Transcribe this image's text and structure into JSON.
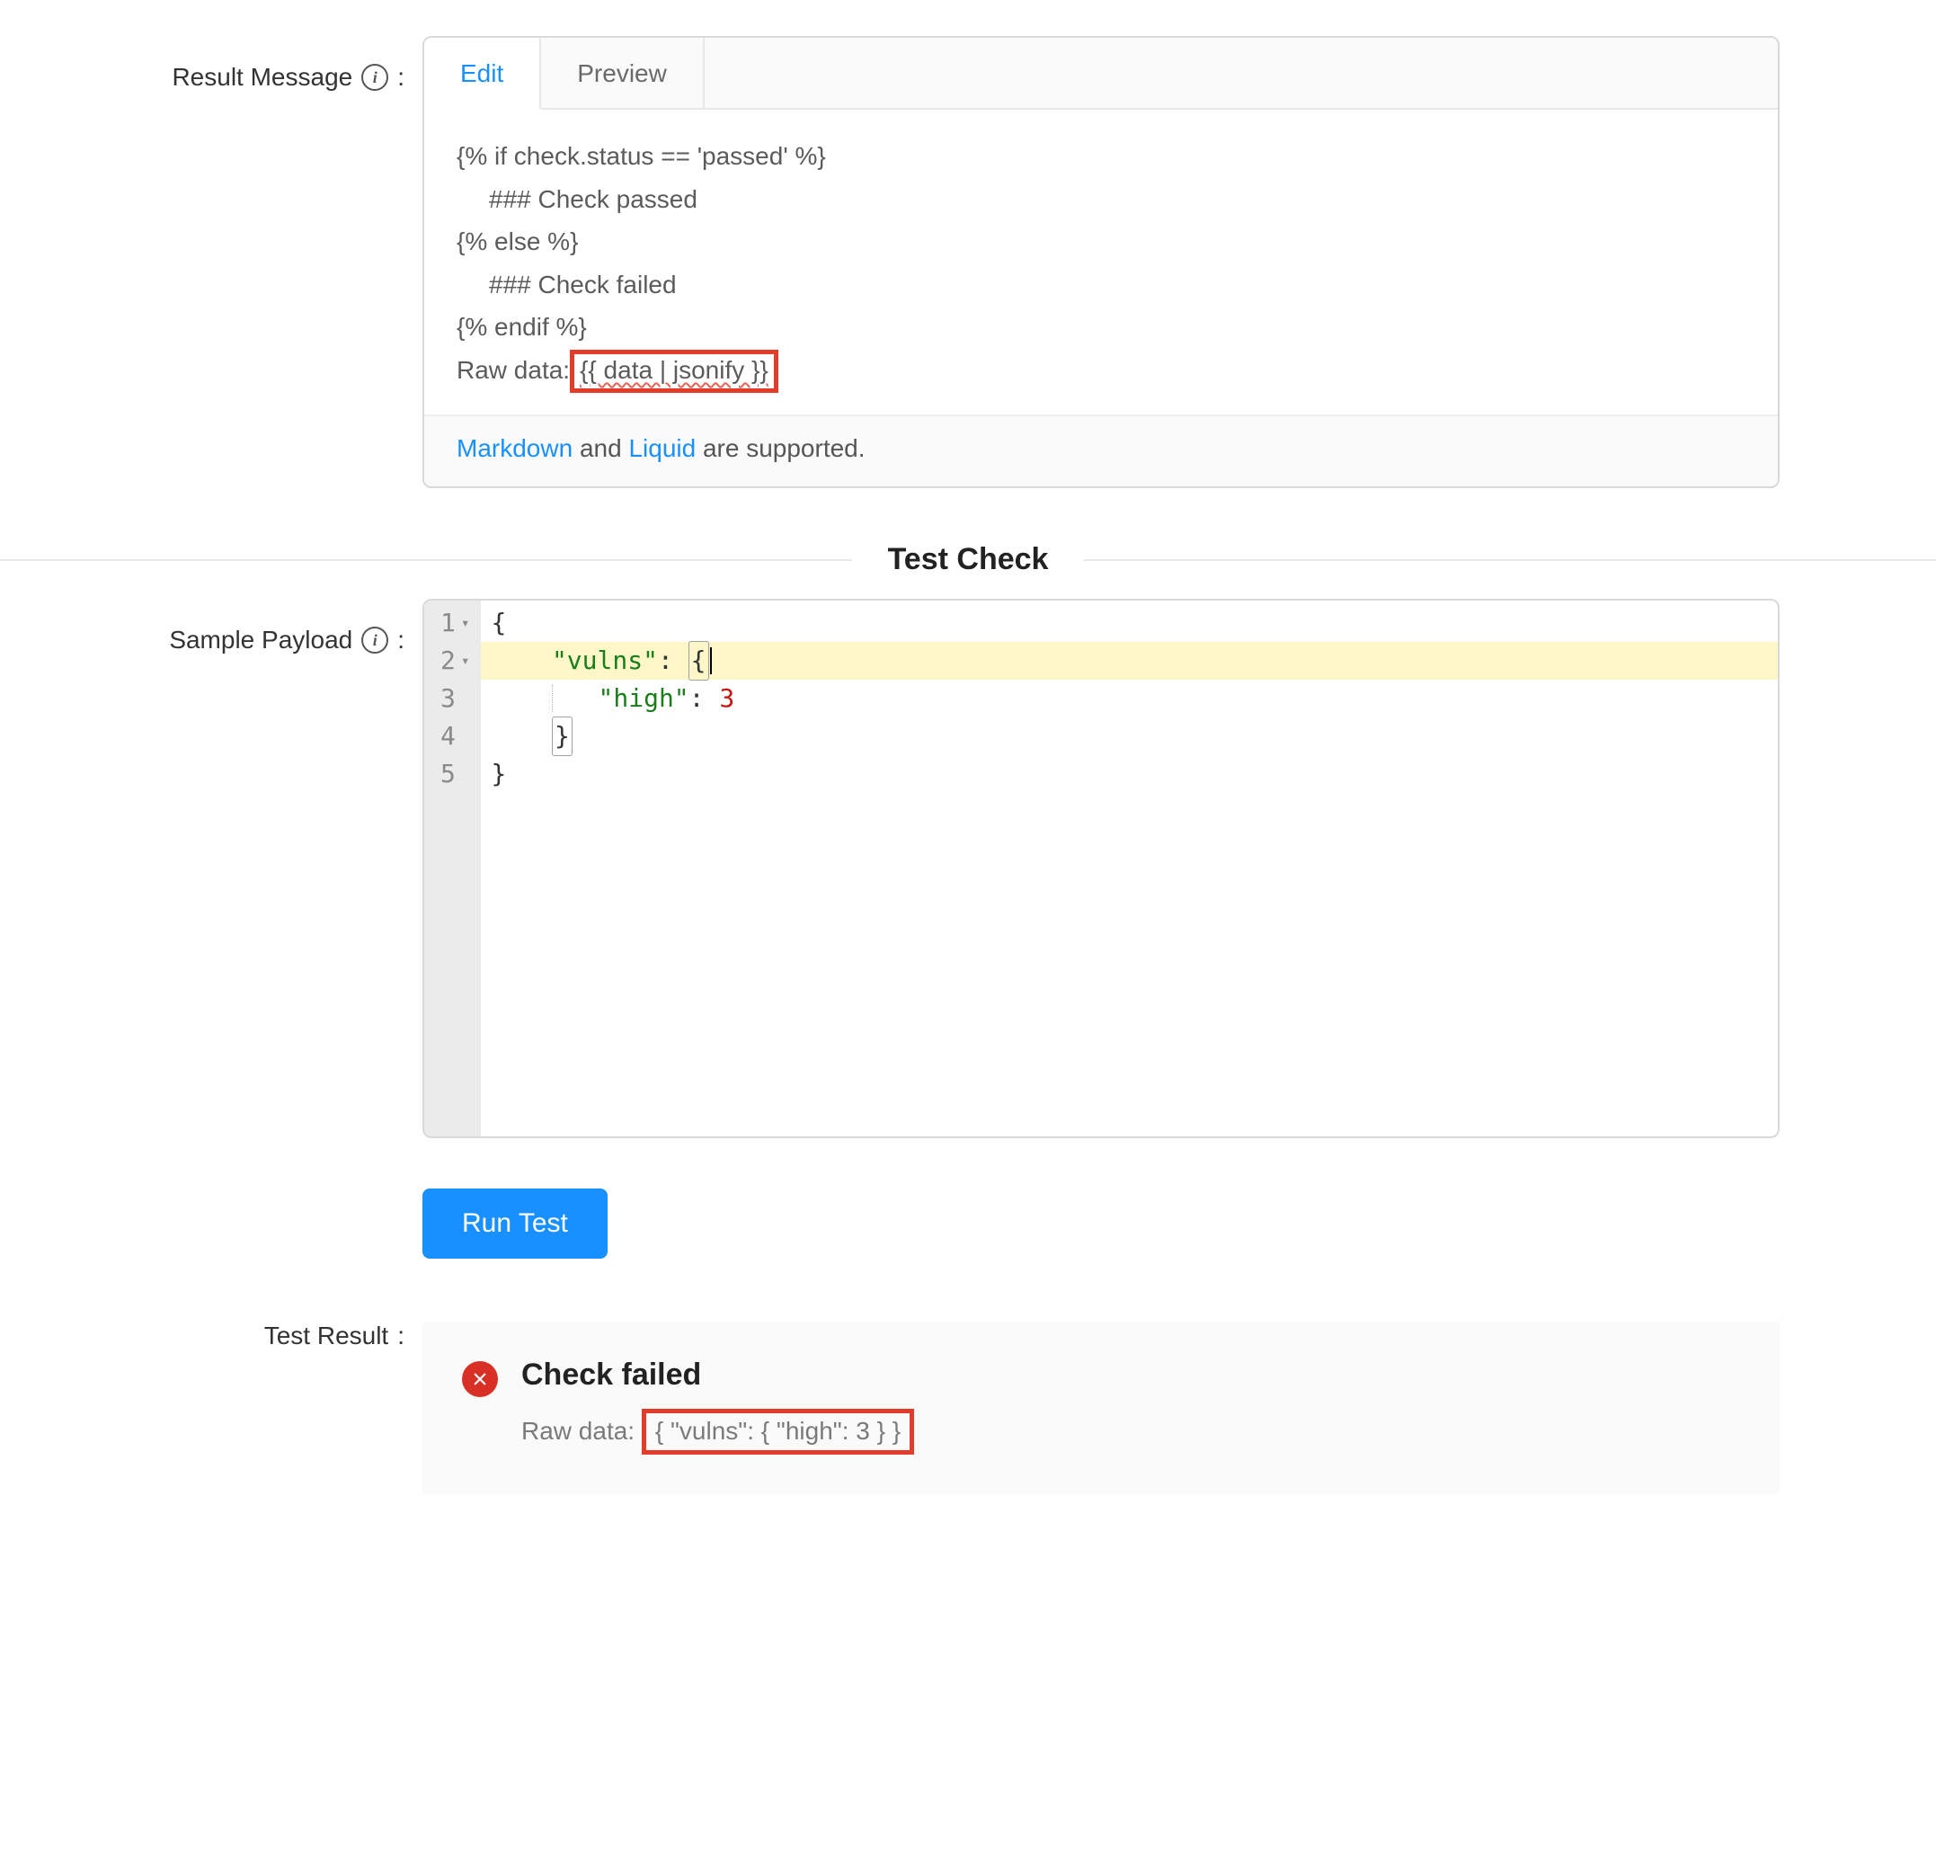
{
  "fields": {
    "result_message": "Result Message",
    "sample_payload": "Sample Payload",
    "test_result": "Test Result",
    "colon": ":"
  },
  "tabs": {
    "edit": "Edit",
    "preview": "Preview"
  },
  "template": {
    "line1": "{% if check.status == 'passed' %}",
    "line2": "### Check passed",
    "line3": "{% else %}",
    "line4": "### Check failed",
    "line5": "{% endif %}",
    "raw_label": "Raw data:",
    "raw_expr": "{{ data | jsonify }}"
  },
  "footer": {
    "markdown": "Markdown",
    "and": " and ",
    "liquid": "Liquid",
    "rest": " are supported."
  },
  "section": {
    "test_check": "Test Check"
  },
  "code": {
    "ln1": "1",
    "ln2": "2",
    "ln3": "3",
    "ln4": "4",
    "ln5": "5",
    "l1": "{",
    "l2_key": "\"vulns\"",
    "l2_colon": ": ",
    "l2_brace": "{",
    "l3_key": "\"high\"",
    "l3_colon": ": ",
    "l3_val": "3",
    "l4": "}",
    "l5": "}"
  },
  "buttons": {
    "run_test": "Run Test"
  },
  "result": {
    "title": "Check failed",
    "raw_label": "Raw data: ",
    "raw_value": "{ \"vulns\": { \"high\": 3 } }"
  }
}
